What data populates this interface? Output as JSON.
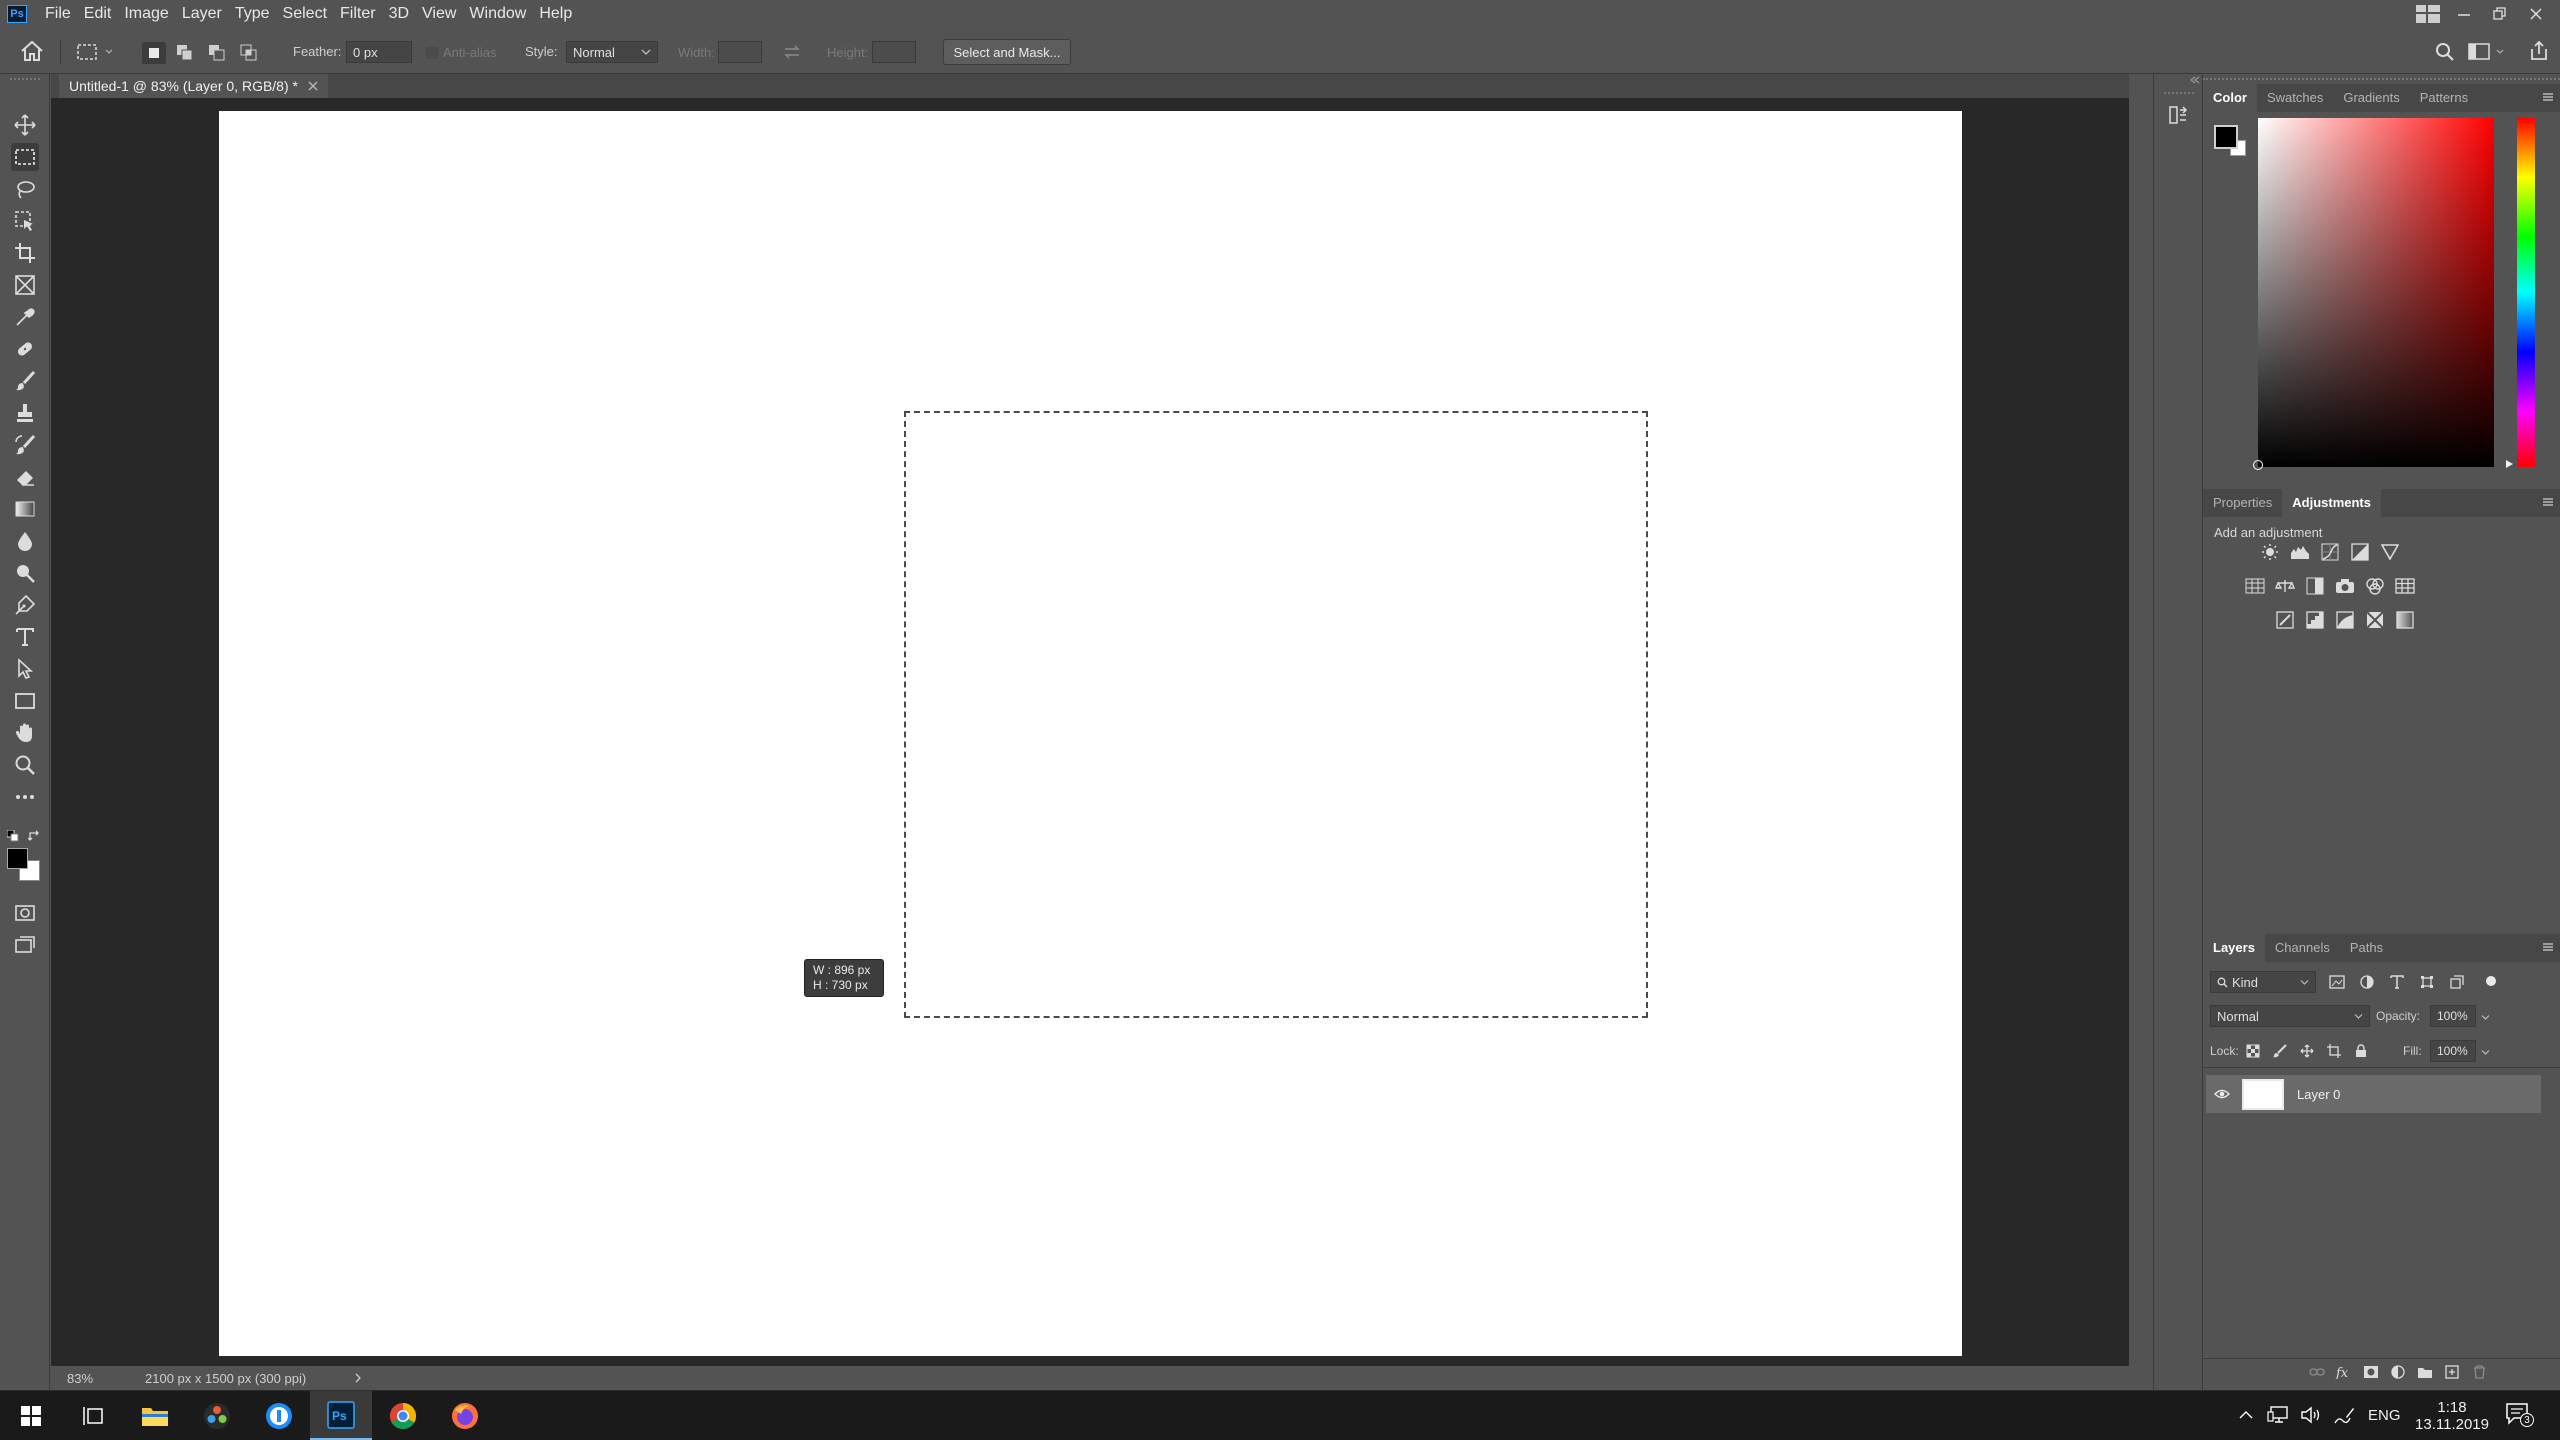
{
  "app": {
    "logo_text": "Ps"
  },
  "menu": [
    "File",
    "Edit",
    "Image",
    "Layer",
    "Type",
    "Select",
    "Filter",
    "3D",
    "View",
    "Window",
    "Help"
  ],
  "options": {
    "feather_label": "Feather:",
    "feather_value": "0 px",
    "antialias_label": "Anti-alias",
    "style_label": "Style:",
    "style_value": "Normal",
    "width_label": "Width:",
    "height_label": "Height:",
    "select_mask_button": "Select and Mask..."
  },
  "document": {
    "tab_title": "Untitled-1 @ 83% (Layer 0, RGB/8) *",
    "zoom": "83%",
    "info": "2100 px x 1500 px (300 ppi)",
    "tooltip_w": "W : 896 px",
    "tooltip_h": "H : 730 px"
  },
  "panels": {
    "color_tabs": [
      "Color",
      "Swatches",
      "Gradients",
      "Patterns"
    ],
    "adjust_tabs": [
      "Properties",
      "Adjustments"
    ],
    "add_adjustment": "Add an adjustment",
    "layers_tabs": [
      "Layers",
      "Channels",
      "Paths"
    ],
    "filter_kind": "Kind",
    "blend_mode": "Normal",
    "opacity_label": "Opacity:",
    "opacity_value": "100%",
    "lock_label": "Lock:",
    "fill_label": "Fill:",
    "fill_value": "100%",
    "layers": [
      {
        "name": "Layer 0"
      }
    ]
  },
  "taskbar": {
    "language": "ENG",
    "time": "1:18",
    "date": "13.11.2019",
    "notification_count": "3"
  },
  "colors": {
    "foreground": "#000000",
    "background": "#ffffff",
    "accent": "#31a8ff",
    "color_field_hue": "#ff0000"
  }
}
